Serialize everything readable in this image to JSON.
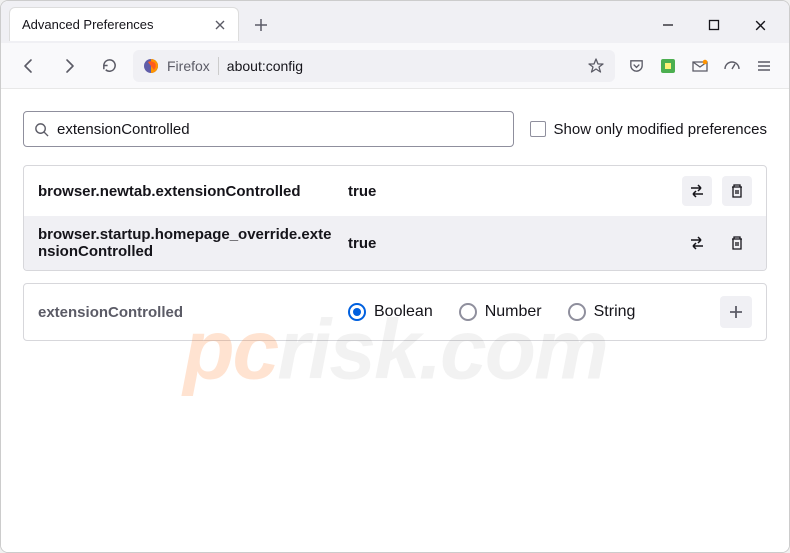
{
  "titlebar": {
    "tab_title": "Advanced Preferences"
  },
  "toolbar": {
    "firefox_label": "Firefox",
    "url": "about:config"
  },
  "search": {
    "value": "extensionControlled",
    "checkbox_label": "Show only modified preferences"
  },
  "prefs": [
    {
      "name": "browser.newtab.extensionControlled",
      "value": "true"
    },
    {
      "name": "browser.startup.homepage_override.extensionControlled",
      "value": "true"
    }
  ],
  "new_pref": {
    "name": "extensionControlled",
    "types": [
      {
        "label": "Boolean",
        "checked": true
      },
      {
        "label": "Number",
        "checked": false
      },
      {
        "label": "String",
        "checked": false
      }
    ]
  },
  "watermark": {
    "prefix": "pc",
    "suffix": "risk.com"
  }
}
